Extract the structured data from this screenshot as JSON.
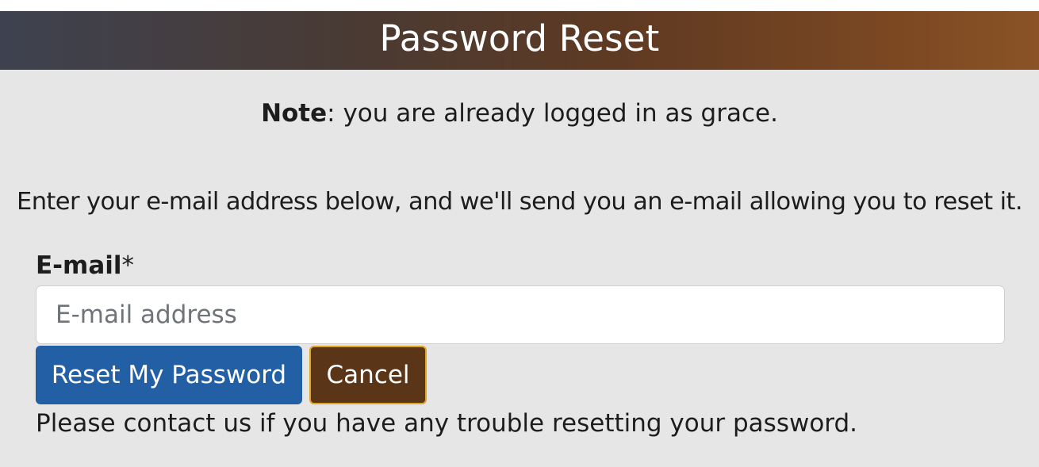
{
  "header": {
    "title": "Password Reset"
  },
  "note": {
    "label": "Note",
    "text": ": you are already logged in as grace."
  },
  "instructions": "Enter your e-mail address below, and we'll send you an e-mail allowing you to reset it.",
  "form": {
    "email_label": "E-mail",
    "required_marker": "*",
    "email_placeholder": "E-mail address",
    "email_value": "",
    "submit_label": "Reset My Password",
    "cancel_label": "Cancel"
  },
  "help_text": "Please contact us if you have any trouble resetting your password.",
  "colors": {
    "primary_button": "#235fa4",
    "cancel_button": "#5a3518",
    "cancel_border": "#e0a424",
    "content_background": "#e6e6e6"
  }
}
